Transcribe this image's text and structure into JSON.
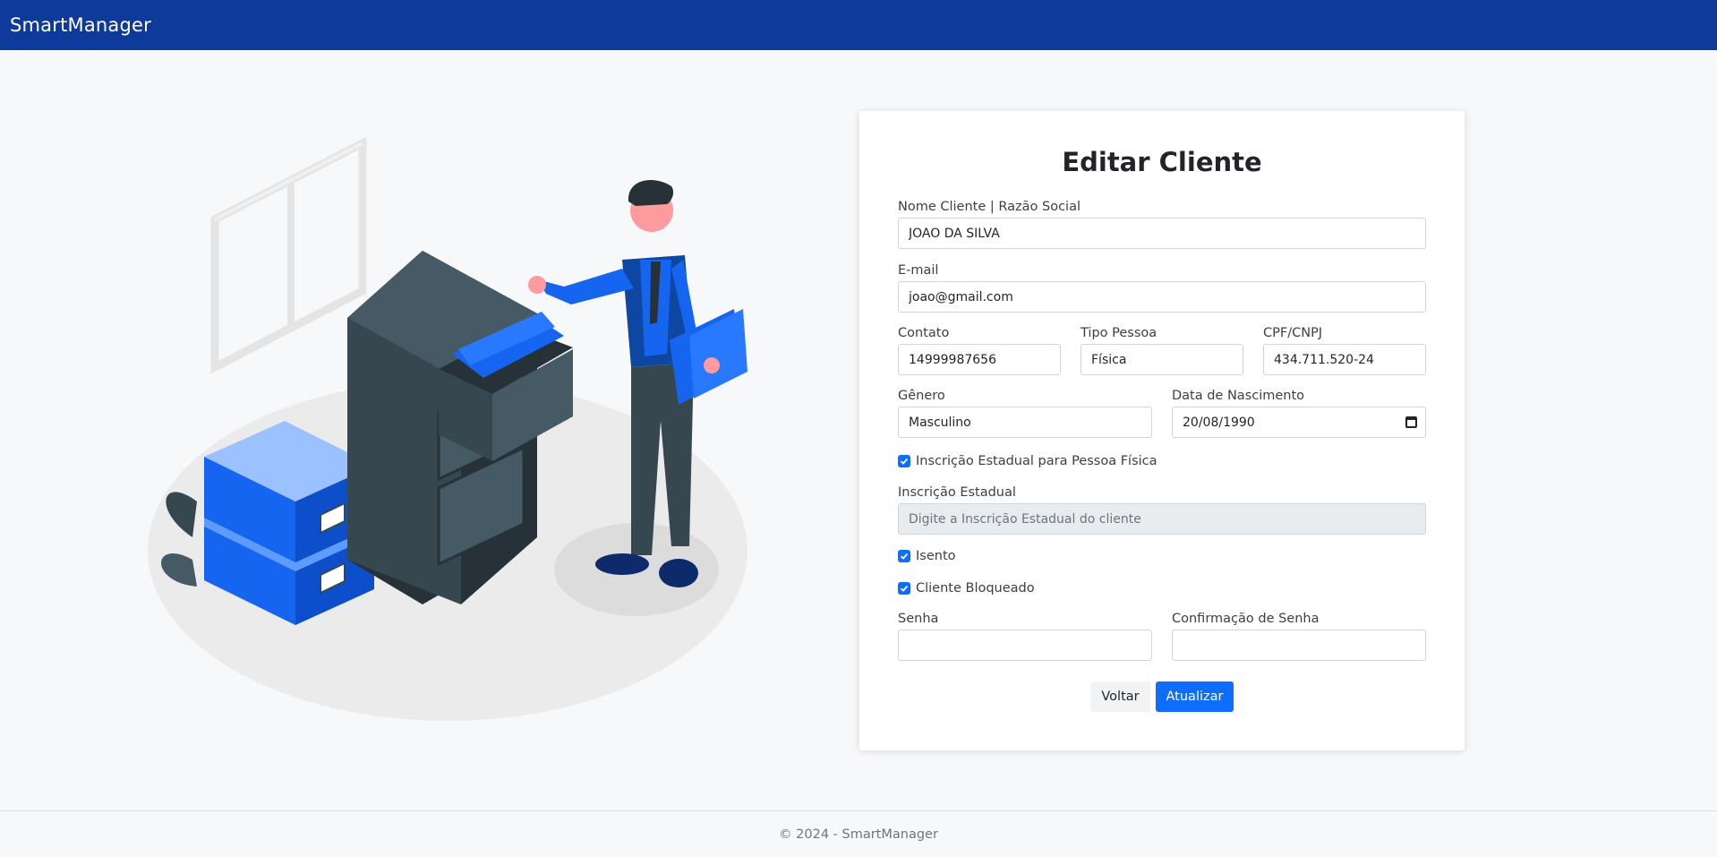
{
  "navbar": {
    "brand": "SmartManager"
  },
  "form": {
    "title": "Editar Cliente",
    "nome": {
      "label": "Nome Cliente | Razão Social",
      "value": "JOAO DA SILVA"
    },
    "email": {
      "label": "E-mail",
      "value": "joao@gmail.com"
    },
    "contato": {
      "label": "Contato",
      "value": "14999987656"
    },
    "tipo_pessoa": {
      "label": "Tipo Pessoa",
      "value": "Física"
    },
    "cpf_cnpj": {
      "label": "CPF/CNPJ",
      "value": "434.711.520-24"
    },
    "genero": {
      "label": "Gênero",
      "value": "Masculino"
    },
    "data_nascimento": {
      "label": "Data de Nascimento",
      "value": "20/08/1990"
    },
    "ie_pessoa_fisica": {
      "label": "Inscrição Estadual para Pessoa Física",
      "checked": true
    },
    "inscricao_estadual": {
      "label": "Inscrição Estadual",
      "placeholder": "Digite a Inscrição Estadual do cliente",
      "value": ""
    },
    "isento": {
      "label": "Isento",
      "checked": true
    },
    "bloqueado": {
      "label": "Cliente Bloqueado",
      "checked": true
    },
    "senha": {
      "label": "Senha",
      "value": ""
    },
    "confirmacao_senha": {
      "label": "Confirmação de Senha",
      "value": ""
    },
    "buttons": {
      "back_label": "Voltar",
      "update_label": "Atualizar"
    }
  },
  "footer": {
    "text": "© 2024 - SmartManager"
  },
  "colors": {
    "navbar": "#0e3b9b",
    "primary": "#0d6efd",
    "page_background": "#f7f8fa",
    "illustration_blue": "#1565f0"
  },
  "icons": {
    "checkbox": "check-icon",
    "date_picker": "calendar-icon",
    "illustration": "filing-cabinet-illustration"
  }
}
